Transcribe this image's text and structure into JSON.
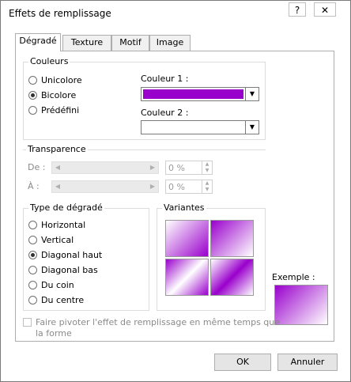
{
  "window": {
    "title": "Effets de remplissage",
    "help_label": "?",
    "close_label": "✕"
  },
  "tabs": [
    {
      "label": "Dégradé"
    },
    {
      "label": "Texture"
    },
    {
      "label": "Motif"
    },
    {
      "label": "Image"
    }
  ],
  "couleurs": {
    "group_label": "Couleurs",
    "options": [
      {
        "label": "Unicolore",
        "checked": false
      },
      {
        "label": "Bicolore",
        "checked": true
      },
      {
        "label": "Prédéfini",
        "checked": false
      }
    ],
    "couleur1_label": "Couleur 1 :",
    "couleur1_color": "#9900cc",
    "couleur2_label": "Couleur 2 :"
  },
  "transparence": {
    "group_label": "Transparence",
    "de_label": "De :",
    "a_label": "À :",
    "de_value": "0 %",
    "a_value": "0 %"
  },
  "type_degrade": {
    "group_label": "Type de dégradé",
    "options": [
      {
        "label": "Horizontal",
        "checked": false
      },
      {
        "label": "Vertical",
        "checked": false
      },
      {
        "label": "Diagonal haut",
        "checked": true
      },
      {
        "label": "Diagonal bas",
        "checked": false
      },
      {
        "label": "Du coin",
        "checked": false
      },
      {
        "label": "Du centre",
        "checked": false
      }
    ]
  },
  "variantes": {
    "group_label": "Variantes"
  },
  "exemple": {
    "label": "Exemple :"
  },
  "rotate_checkbox": {
    "label_line1": "Faire pivoter l'effet de remplissage en même temps que",
    "label_line2": "la forme"
  },
  "buttons": {
    "ok": "OK",
    "cancel": "Annuler"
  },
  "colors": {
    "accent": "#9900cc",
    "accent_light": "#ffffff"
  }
}
